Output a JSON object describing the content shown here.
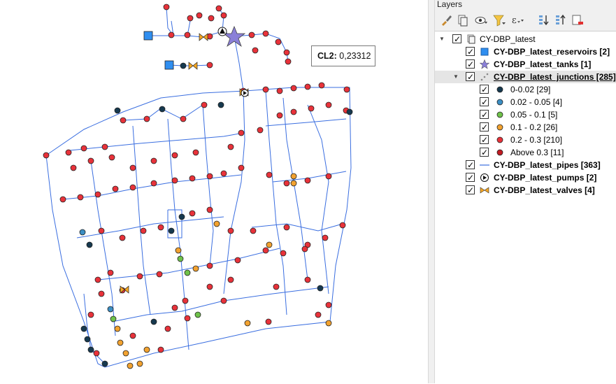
{
  "tooltip": {
    "key": "CL2:",
    "value": "0,23312"
  },
  "panel": {
    "title": "Layers",
    "toolbar": [
      {
        "icon": "brush-icon",
        "name": "open-layer-styling-button"
      },
      {
        "icon": "add-group-icon",
        "name": "add-group-button"
      },
      {
        "icon": "eye-icon",
        "name": "manage-visibility-button"
      },
      {
        "icon": "filter-icon",
        "name": "filter-legend-button"
      },
      {
        "icon": "expression-filter-icon",
        "name": "filter-by-expression-button"
      },
      {
        "icon": "expand-all-icon",
        "name": "expand-all-button"
      },
      {
        "icon": "collapse-all-icon",
        "name": "collapse-all-button"
      },
      {
        "icon": "remove-layer-icon",
        "name": "remove-layer-button"
      }
    ],
    "tree": {
      "group": {
        "label": "CY-DBP_latest"
      },
      "layers": {
        "reservoirs": "CY-DBP_latest_reservoirs [2]",
        "tanks": "CY-DBP_latest_tanks [1]",
        "junctions": "CY-DBP_latest_junctions [285]",
        "pipes": "CY-DBP_latest_pipes [363]",
        "pumps": "CY-DBP_latest_pumps [2]",
        "valves": "CY-DBP_latest_valves [4]"
      },
      "classes": [
        {
          "label": "0-0.02 [29]",
          "color": "#16394f"
        },
        {
          "label": "0.02 - 0.05 [4]",
          "color": "#3c8fc4"
        },
        {
          "label": "0.05 - 0.1 [5]",
          "color": "#6fc24a"
        },
        {
          "label": "0.1 - 0.2 [26]",
          "color": "#f2a230"
        },
        {
          "label": "0.2 - 0.3 [210]",
          "color": "#e8323a"
        },
        {
          "label": "Above 0.3 [11]",
          "color": "#c11b22"
        }
      ]
    }
  },
  "colors": {
    "pipe": "#3a6ee0",
    "reservoir": "#2f8ef0",
    "tank": "#8a7fd8",
    "valve": "#f5a623",
    "node_outline": "#222222"
  }
}
